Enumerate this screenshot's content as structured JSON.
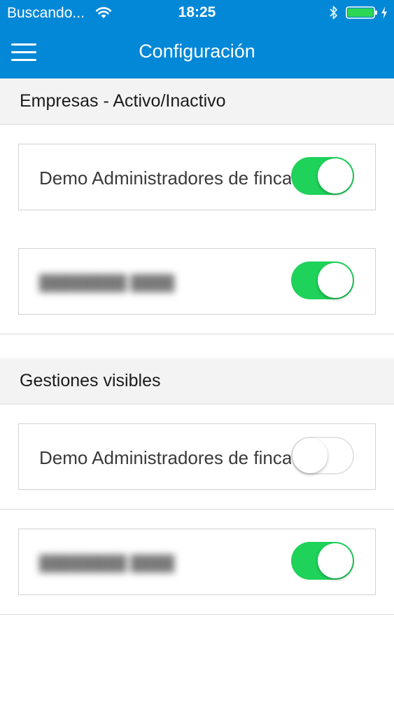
{
  "status_bar": {
    "carrier": "Buscando...",
    "time": "18:25",
    "icons": [
      "wifi-icon",
      "bluetooth-icon",
      "battery-icon",
      "charge-icon"
    ],
    "battery_color": "#2bd655"
  },
  "nav": {
    "title": "Configuración",
    "menu_icon": "hamburger-menu-icon",
    "background_color": "#0288d6"
  },
  "sections": [
    {
      "title": "Empresas - Activo/Inactivo",
      "rows": [
        {
          "label": "Demo Administradores de fincas",
          "enabled": true,
          "blurred": false
        },
        {
          "label": "████████ ████",
          "enabled": true,
          "blurred": true
        }
      ]
    },
    {
      "title": "Gestiones visibles",
      "rows": [
        {
          "label": "Demo Administradores de fincas",
          "enabled": false,
          "blurred": false
        },
        {
          "label": "████████ ████",
          "enabled": true,
          "blurred": true
        }
      ]
    }
  ],
  "colors": {
    "toggle_on": "#1fd25a",
    "toggle_off_border": "#e4e4e4",
    "section_header_bg": "#f3f3f4"
  }
}
